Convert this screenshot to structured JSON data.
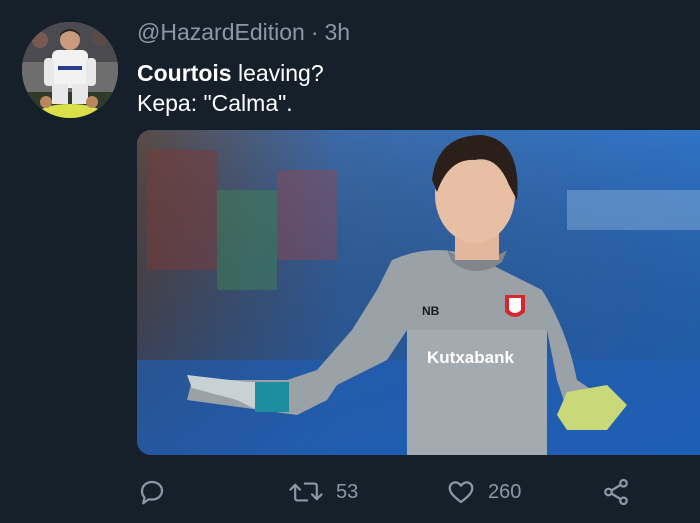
{
  "tweet": {
    "handle": "@HazardEdition",
    "separator": "·",
    "time": "3h",
    "text_bold": "Courtois",
    "text_rest": " leaving?",
    "text_line2": "Kepa: \"Calma\".",
    "media": {
      "jersey_text": "Kutxabank"
    }
  },
  "actions": {
    "retweets": "53",
    "likes": "260"
  },
  "icons": {
    "reply": "reply-icon",
    "retweet": "retweet-icon",
    "like": "heart-icon",
    "share": "share-icon"
  },
  "colors": {
    "background": "#15202b",
    "secondary_text": "#8b98a5"
  }
}
